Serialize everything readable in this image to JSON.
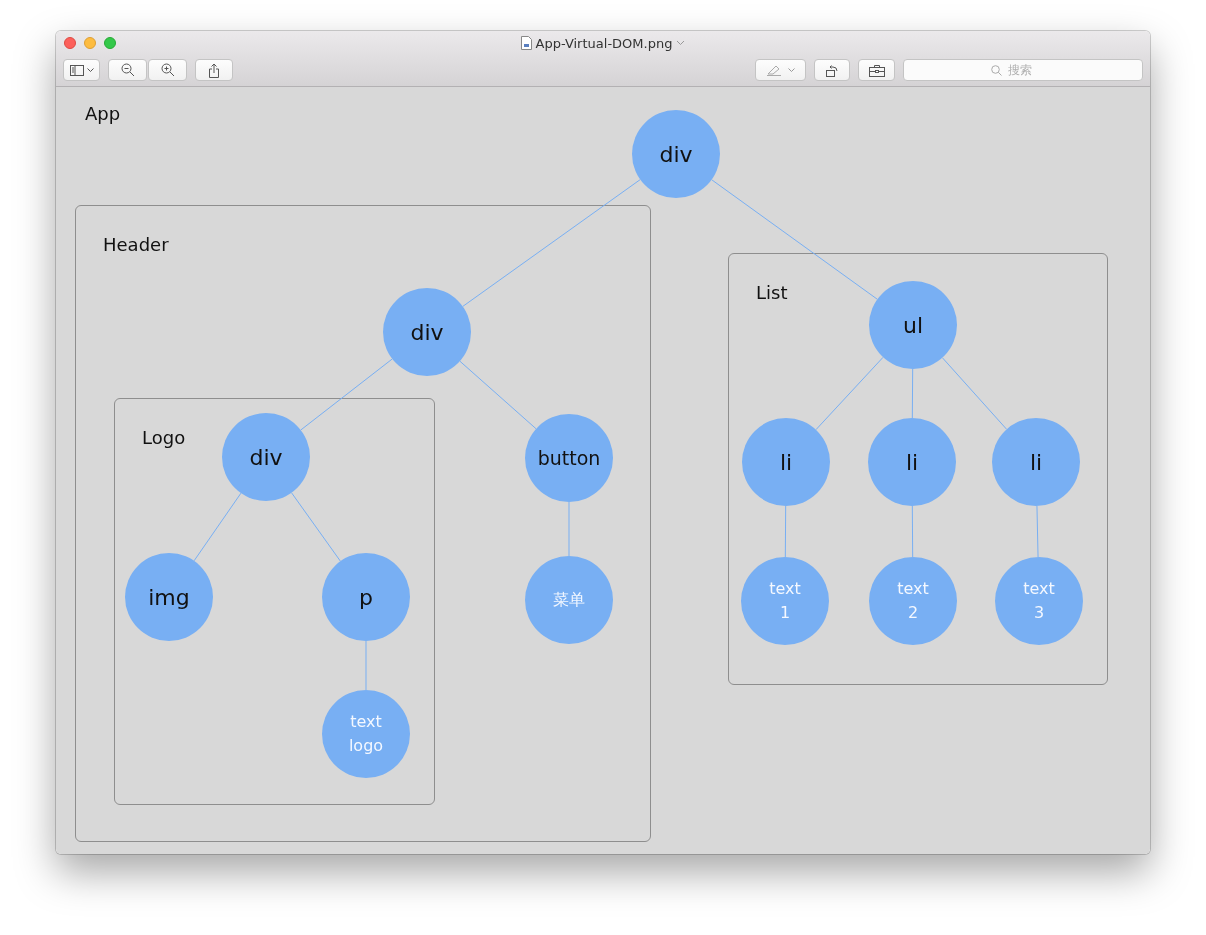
{
  "window": {
    "title": "App-Virtual-DOM.png"
  },
  "toolbar": {
    "search": {
      "placeholder": "搜索"
    }
  },
  "diagram": {
    "groups": [
      {
        "label": "App",
        "framed": false
      },
      {
        "label": "Header",
        "framed": true
      },
      {
        "label": "Logo",
        "framed": true
      },
      {
        "label": "List",
        "framed": true
      }
    ],
    "tree": {
      "label": "div",
      "kind": "element",
      "children": [
        {
          "label": "div",
          "kind": "element",
          "children": [
            {
              "label": "div",
              "kind": "element",
              "children": [
                {
                  "label": "img",
                  "kind": "element"
                },
                {
                  "label": "p",
                  "kind": "element",
                  "children": [
                    {
                      "label": "text\nlogo",
                      "kind": "text"
                    }
                  ]
                }
              ]
            },
            {
              "label": "button",
              "kind": "element",
              "children": [
                {
                  "label": "菜单",
                  "kind": "text"
                }
              ]
            }
          ]
        },
        {
          "label": "ul",
          "kind": "element",
          "children": [
            {
              "label": "li",
              "kind": "element",
              "children": [
                {
                  "label": "text\n1",
                  "kind": "text"
                }
              ]
            },
            {
              "label": "li",
              "kind": "element",
              "children": [
                {
                  "label": "text\n2",
                  "kind": "text"
                }
              ]
            },
            {
              "label": "li",
              "kind": "element",
              "children": [
                {
                  "label": "text\n3",
                  "kind": "text"
                }
              ]
            }
          ]
        }
      ]
    }
  }
}
